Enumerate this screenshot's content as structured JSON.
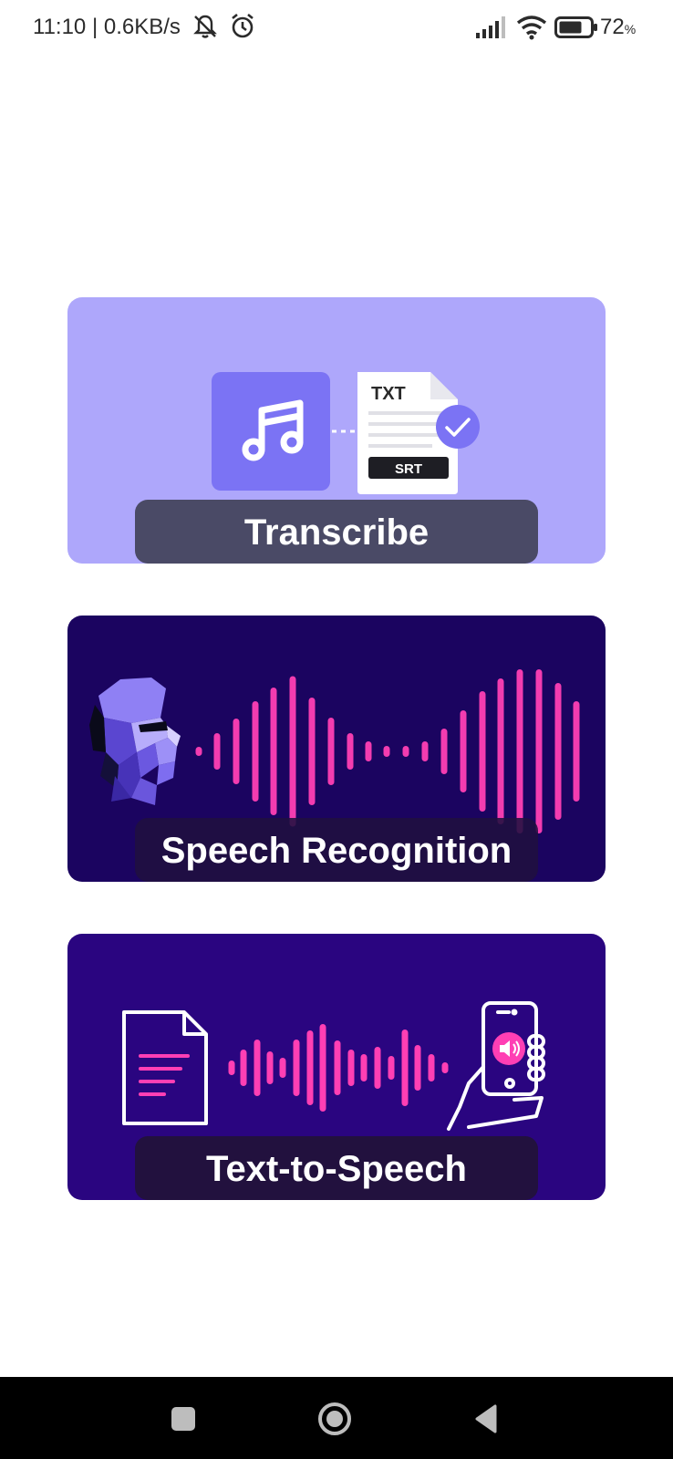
{
  "status_bar": {
    "time_speed": "11:10 | 0.6KB/s",
    "battery_percent": "72",
    "battery_unit": "%",
    "icons": [
      "mute-icon",
      "alarm-icon",
      "signal-icon",
      "wifi-icon",
      "battery-icon"
    ]
  },
  "cards": {
    "transcribe": {
      "label": "Transcribe",
      "file_formats": [
        "TXT",
        "SRT"
      ],
      "bg_color": "#aea7fb",
      "label_bg": "#4a4a66"
    },
    "speech_recognition": {
      "label": "Speech Recognition",
      "bg_color": "#1b0460",
      "label_bg": "#20103f"
    },
    "text_to_speech": {
      "label": "Text-to-Speech",
      "bg_color": "#2a0580",
      "label_bg": "#22113e"
    }
  },
  "accent_colors": {
    "pink": "#ff3fb4",
    "purple": "#7b73f4"
  },
  "nav_bar": {
    "buttons": [
      "recent-apps-icon",
      "home-icon",
      "back-icon"
    ]
  }
}
